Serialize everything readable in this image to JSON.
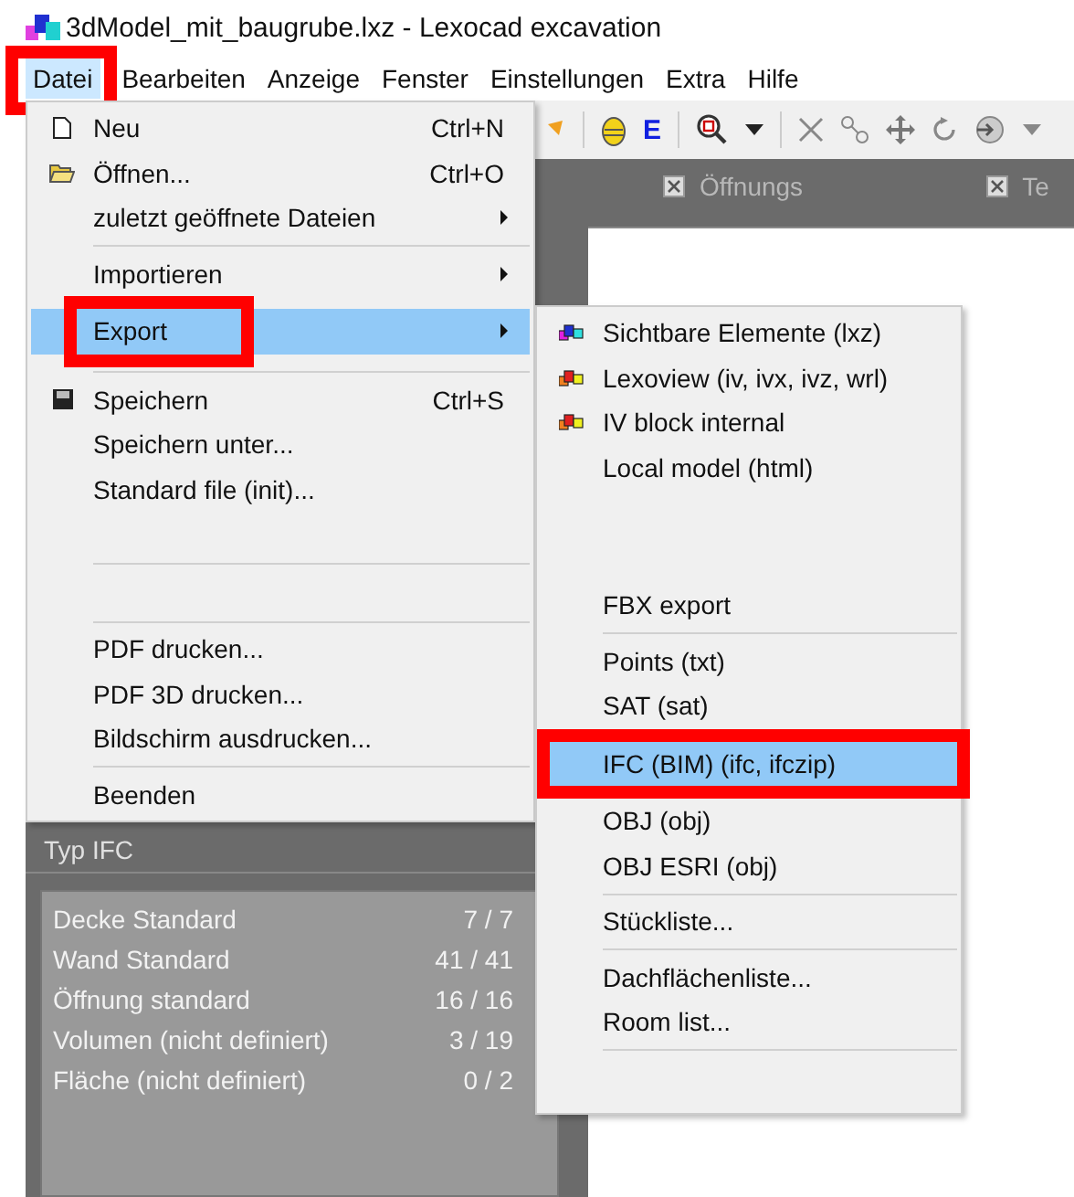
{
  "window": {
    "title": "3dModel_mit_baugrube.lxz - Lexocad excavation"
  },
  "menubar": [
    {
      "label": "Datei",
      "selected": true,
      "annotated": true
    },
    {
      "label": "Bearbeiten",
      "selected": false,
      "annotated": false
    },
    {
      "label": "Anzeige",
      "selected": false,
      "annotated": false
    },
    {
      "label": "Fenster",
      "selected": false,
      "annotated": false
    },
    {
      "label": "Einstellungen",
      "selected": false,
      "annotated": false
    },
    {
      "label": "Extra",
      "selected": false,
      "annotated": false
    },
    {
      "label": "Hilfe",
      "selected": false,
      "annotated": false
    }
  ],
  "toolbar": {
    "text_button": "E"
  },
  "tabs": [
    {
      "label": "Öffnungs"
    },
    {
      "label": "Te"
    }
  ],
  "panel": {
    "title": "Typ IFC",
    "rows": [
      {
        "name": "Decke Standard",
        "count": "7 / 7"
      },
      {
        "name": "Wand Standard",
        "count": "41 / 41"
      },
      {
        "name": "Öffnung standard",
        "count": "16 / 16"
      },
      {
        "name": "Volumen (nicht definiert)",
        "count": "3 / 19"
      },
      {
        "name": "Fläche (nicht definiert)",
        "count": "0 / 2"
      }
    ]
  },
  "file_menu": [
    {
      "kind": "item",
      "label": "Neu",
      "shortcut": "Ctrl+N",
      "submenu": false,
      "selected": false,
      "annotated": false
    },
    {
      "kind": "item",
      "label": "Öffnen...",
      "shortcut": "Ctrl+O",
      "submenu": false,
      "selected": false,
      "annotated": false
    },
    {
      "kind": "item",
      "label": "zuletzt geöffnete Dateien",
      "submenu": true,
      "selected": false,
      "annotated": false
    },
    {
      "kind": "separator"
    },
    {
      "kind": "item",
      "label": "Importieren",
      "submenu": true,
      "selected": false,
      "annotated": false
    },
    {
      "kind": "item",
      "label": "Export",
      "submenu": true,
      "selected": true,
      "annotated": true
    },
    {
      "kind": "separator"
    },
    {
      "kind": "item",
      "label": "Speichern",
      "shortcut": "Ctrl+S",
      "submenu": false,
      "selected": false,
      "annotated": false
    },
    {
      "kind": "item",
      "label": "Speichern unter...",
      "submenu": false,
      "selected": false,
      "annotated": false
    },
    {
      "kind": "item",
      "label": "Standard file (init)...",
      "submenu": false,
      "selected": false,
      "annotated": false
    },
    {
      "kind": "blank"
    },
    {
      "kind": "separator"
    },
    {
      "kind": "blank"
    },
    {
      "kind": "separator"
    },
    {
      "kind": "item",
      "label": "PDF drucken...",
      "submenu": false,
      "selected": false,
      "annotated": false
    },
    {
      "kind": "item",
      "label": "PDF 3D drucken...",
      "submenu": false,
      "selected": false,
      "annotated": false
    },
    {
      "kind": "item",
      "label": "Bildschirm ausdrucken...",
      "submenu": false,
      "selected": false,
      "annotated": false
    },
    {
      "kind": "separator"
    },
    {
      "kind": "item",
      "label": "Beenden",
      "submenu": false,
      "selected": false,
      "annotated": false
    }
  ],
  "export_menu": [
    {
      "kind": "item",
      "label": "Sichtbare Elemente (lxz)",
      "selected": false,
      "annotated": false
    },
    {
      "kind": "item",
      "label": "Lexoview (iv, ivx, ivz, wrl)",
      "selected": false,
      "annotated": false
    },
    {
      "kind": "item",
      "label": "IV block internal",
      "selected": false,
      "annotated": false
    },
    {
      "kind": "item",
      "label": "Local model (html)",
      "selected": false,
      "annotated": false
    },
    {
      "kind": "blank"
    },
    {
      "kind": "blank"
    },
    {
      "kind": "item",
      "label": "FBX export",
      "selected": false,
      "annotated": false
    },
    {
      "kind": "separator"
    },
    {
      "kind": "item",
      "label": "Points (txt)",
      "selected": false,
      "annotated": false
    },
    {
      "kind": "item",
      "label": "SAT (sat)",
      "selected": false,
      "annotated": false
    },
    {
      "kind": "item",
      "label": "IFC (BIM) (ifc, ifczip)",
      "selected": true,
      "annotated": true
    },
    {
      "kind": "item",
      "label": "OBJ (obj)",
      "selected": false,
      "annotated": false
    },
    {
      "kind": "item",
      "label": "OBJ ESRI (obj)",
      "selected": false,
      "annotated": false
    },
    {
      "kind": "separator"
    },
    {
      "kind": "item",
      "label": "Stückliste...",
      "selected": false,
      "annotated": false
    },
    {
      "kind": "separator"
    },
    {
      "kind": "item",
      "label": "Dachflächenliste...",
      "selected": false,
      "annotated": false
    },
    {
      "kind": "item",
      "label": "Room list...",
      "selected": false,
      "annotated": false
    },
    {
      "kind": "separator"
    },
    {
      "kind": "blank"
    }
  ]
}
